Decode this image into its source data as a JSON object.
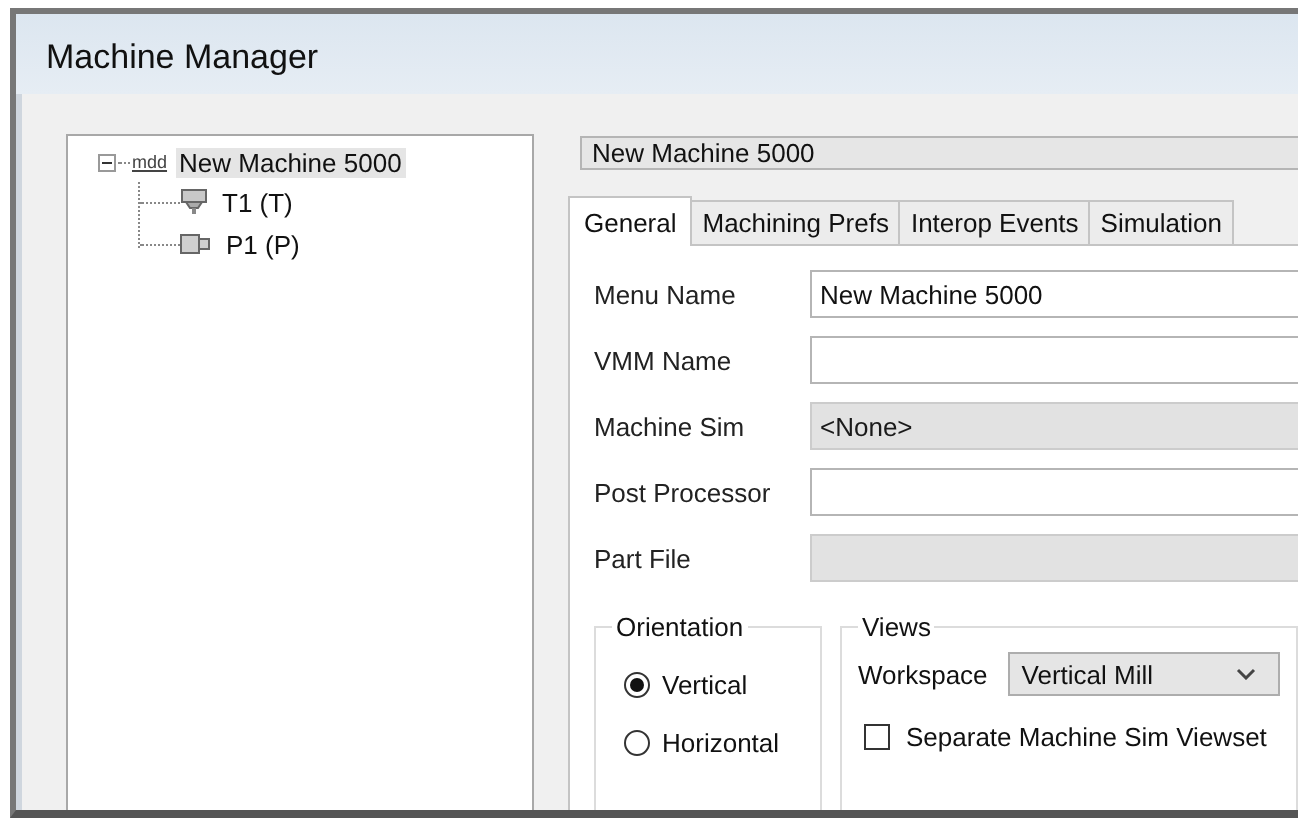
{
  "window": {
    "title": "Machine Manager"
  },
  "tree": [
    {
      "label": "New Machine 5000",
      "badge": "mdd",
      "selected": true,
      "expanded": true,
      "children": [
        {
          "label": "T1 (T)",
          "kind": "tool",
          "selected": false
        },
        {
          "label": "P1 (P)",
          "kind": "post",
          "selected": false
        }
      ]
    }
  ],
  "name_field": {
    "value": "New Machine 5000"
  },
  "tabs": [
    {
      "label": "General",
      "selected": true
    },
    {
      "label": "Machining Prefs",
      "selected": false
    },
    {
      "label": "Interop Events",
      "selected": false
    },
    {
      "label": "Simulation",
      "selected": false
    }
  ],
  "fields": [
    {
      "label": "Menu Name",
      "value": "New Machine 5000",
      "disabled": false
    },
    {
      "label": "VMM Name",
      "disabled": false
    },
    {
      "label": "Machine Sim",
      "value": "<None>",
      "disabled": true
    },
    {
      "label": "Post Processor",
      "disabled": false
    },
    {
      "label": "Part File",
      "disabled": true
    }
  ],
  "orientation": {
    "title": "Orientation",
    "options": [
      {
        "label": "Vertical",
        "selected": true
      },
      {
        "label": "Horizontal",
        "selected": false
      }
    ]
  },
  "views": {
    "title": "Views",
    "workspace": {
      "label": "Workspace",
      "value": "Vertical Mill"
    },
    "separate_viewset": {
      "label": "Separate Machine Sim Viewset",
      "checked": false
    }
  }
}
